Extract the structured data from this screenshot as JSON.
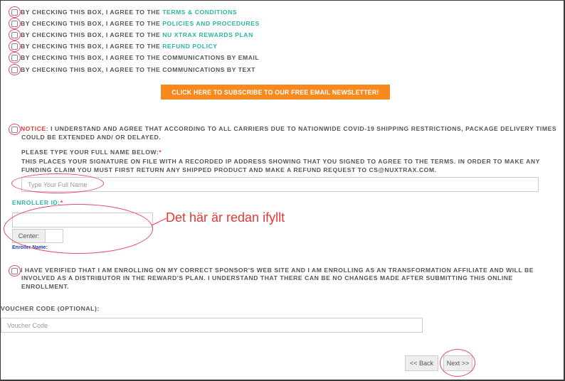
{
  "agreements": [
    {
      "prefix": "BY CHECKING THIS BOX, I AGREE TO THE ",
      "link": "TERMS & CONDITIONS"
    },
    {
      "prefix": "BY CHECKING THIS BOX, I AGREE TO THE ",
      "link": "POLICIES AND PROCEDURES"
    },
    {
      "prefix": "BY CHECKING THIS BOX, I AGREE TO THE ",
      "link": "NU XTRAX REWARDS PLAN"
    },
    {
      "prefix": "BY CHECKING THIS BOX, I AGREE TO THE ",
      "link": "REFUND POLICY"
    },
    {
      "prefix": "BY CHECKING THIS BOX, I AGREE TO THE COMMUNICATIONS BY EMAIL",
      "link": ""
    },
    {
      "prefix": "BY CHECKING THIS BOX, I AGREE TO THE COMMUNICATIONS BY TEXT",
      "link": ""
    }
  ],
  "newsletter_button": "CLICK HERE TO SUBSCRIBE TO OUR FREE EMAIL NEWSLETTER!",
  "notice": {
    "label": "NOTICE:",
    "line1": " I UNDERSTAND AND AGREE THAT ACCORDING TO ALL CARRIERS DUE TO NATIONWIDE COVID-19 SHIPPING RESTRICTIONS, PACKAGE DELIVERY TIMES",
    "line2": "COULD BE EXTENDED AND/ OR DELAYED."
  },
  "full_name": {
    "label": "PLEASE TYPE YOUR FULL NAME BELOW:",
    "required_mark": "*",
    "info_line1": "THIS PLACES YOUR SIGNATURE ON FILE WITH A RECORDED IP ADDRESS SHOWING THAT YOU SIGNED TO AGREE TO THE TERMS. IN ORDER TO MAKE ANY",
    "info_line2": "FUNDING CLAIM YOU MUST FIRST RETURN ANY SHIPPED PRODUCT AND MAKE A REFUND REQUEST TO CS@NUXTRAX.COM.",
    "placeholder": "Type Your Full Name"
  },
  "enroller": {
    "label": "ENROLLER ID:",
    "required_mark": "*",
    "value": "",
    "center_label": "Center:",
    "center_value": "",
    "name_label": "Enroller Name:"
  },
  "annotation": "Det här är redan ifyllt",
  "verify": {
    "line1": "I HAVE VERIFIED THAT I AM ENROLLING ON MY CORRECT SPONSOR'S WEB SITE AND I AM ENROLLING AS AN TRANSFORMATION AFFILIATE AND WILL BE",
    "line2": "INVOLVED AS A DISTRIBUTOR IN THE REWARD'S PLAN. I UNDERSTAND THAT THERE CAN BE NO CHANGES MADE AFTER SUBMITTING THIS ONLINE",
    "line3": "ENROLLMENT."
  },
  "voucher": {
    "label": "VOUCHER CODE (OPTIONAL):",
    "placeholder": "Voucher Code"
  },
  "nav": {
    "back": "<< Back",
    "next": "Next >>"
  },
  "colors": {
    "accent_teal": "#2db5a0",
    "button_orange": "#f7891f",
    "notice_red": "#e53935",
    "annotation_pink": "#e8456f"
  }
}
